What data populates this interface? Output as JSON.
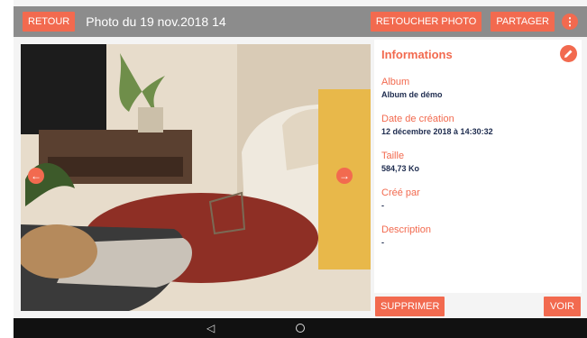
{
  "header": {
    "back_label": "RETOUR",
    "title": "Photo du 19 nov.2018 14",
    "retouch_label": "RETOUCHER PHOTO",
    "share_label": "PARTAGER",
    "more_label": "⋮"
  },
  "photo": {
    "prev_arrow": "←",
    "next_arrow": "→"
  },
  "info": {
    "title": "Informations",
    "fields": [
      {
        "label": "Album",
        "value": "Album de démo"
      },
      {
        "label": "Date de création",
        "value": "12 décembre 2018 à 14:30:32"
      },
      {
        "label": "Taille",
        "value": "584,73 Ko"
      },
      {
        "label": "Créé par",
        "value": "-"
      },
      {
        "label": "Description",
        "value": "-"
      }
    ]
  },
  "actions": {
    "delete_label": "SUPPRIMER",
    "view_label": "VOIR"
  },
  "system_nav": {
    "back_glyph": "◁"
  },
  "colors": {
    "accent": "#f26a4f",
    "topbar": "#8c8c8c",
    "value_text": "#1d2b4e"
  }
}
